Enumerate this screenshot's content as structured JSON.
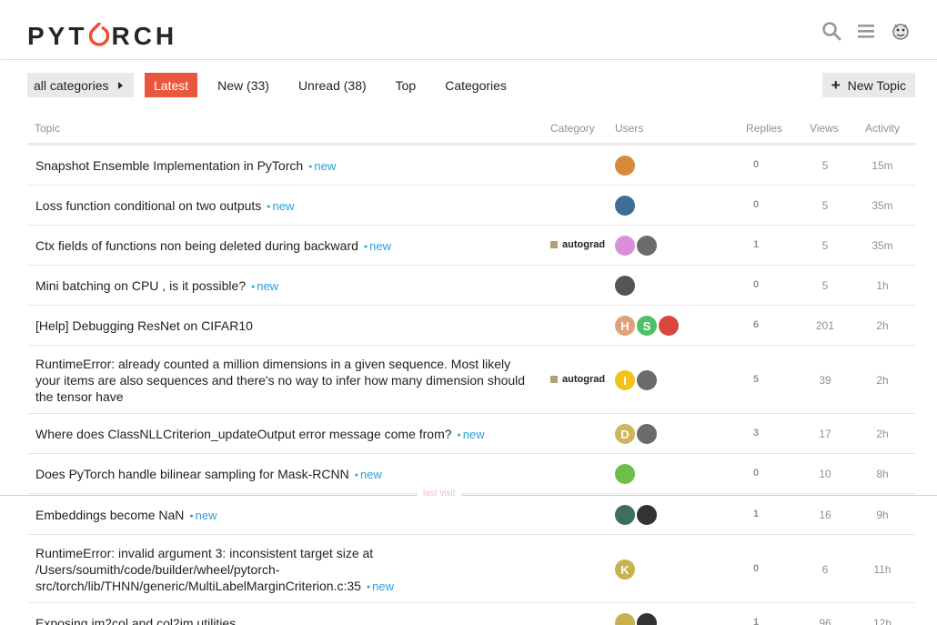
{
  "header": {
    "logo_text": [
      "PYT",
      "RCH"
    ],
    "icons": [
      "search-icon",
      "hamburger-menu-icon",
      "user-avatar-icon"
    ],
    "accent": "#ee4c2c"
  },
  "nav": {
    "category_dropdown": "all categories",
    "tabs": [
      "Latest",
      "New (33)",
      "Unread (38)",
      "Top",
      "Categories"
    ],
    "active_tab": "Latest",
    "new_topic": "New Topic"
  },
  "columns": {
    "topic": "Topic",
    "category": "Category",
    "users": "Users",
    "replies": "Replies",
    "views": "Views",
    "activity": "Activity"
  },
  "new_badge": "new",
  "last_visit_label": "last visit",
  "topics": [
    {
      "title": "Snapshot Ensemble Implementation in PyTorch",
      "new": true,
      "category": "",
      "users": [
        {
          "letter": "",
          "color": "#d88a3b"
        }
      ],
      "replies": "0",
      "views": "5",
      "activity": "15m"
    },
    {
      "title": "Loss function conditional on two outputs",
      "new": true,
      "category": "",
      "users": [
        {
          "letter": "",
          "color": "#3f6d9a"
        }
      ],
      "replies": "0",
      "views": "5",
      "activity": "35m"
    },
    {
      "title": "Ctx fields of functions non being deleted during backward",
      "new": true,
      "category": "autograd",
      "users": [
        {
          "letter": "",
          "color": "#d98fd9"
        },
        {
          "letter": "",
          "color": "#6b6b6b"
        }
      ],
      "replies": "1",
      "views": "5",
      "activity": "35m"
    },
    {
      "title": "Mini batching on CPU , is it possible?",
      "new": true,
      "category": "",
      "users": [
        {
          "letter": "",
          "color": "#555555"
        }
      ],
      "replies": "0",
      "views": "5",
      "activity": "1h"
    },
    {
      "title": "[Help] Debugging ResNet on CIFAR10",
      "new": false,
      "category": "",
      "users": [
        {
          "letter": "H",
          "color": "#e0a07a"
        },
        {
          "letter": "S",
          "color": "#4fbf6a"
        },
        {
          "letter": "",
          "color": "#d9473f"
        }
      ],
      "replies": "6",
      "views": "201",
      "activity": "2h"
    },
    {
      "title": "RuntimeError: already counted a million dimensions in a given sequence. Most likely your items are also sequences and there's no way to infer how many dimension should the tensor have",
      "new": false,
      "category": "autograd",
      "users": [
        {
          "letter": "I",
          "color": "#f2c318"
        },
        {
          "letter": "",
          "color": "#6b6b6b"
        }
      ],
      "replies": "5",
      "views": "39",
      "activity": "2h"
    },
    {
      "title": "Where does ClassNLLCriterion_updateOutput error message come from?",
      "new": true,
      "category": "",
      "users": [
        {
          "letter": "D",
          "color": "#cfb65a"
        },
        {
          "letter": "",
          "color": "#6b6b6b"
        }
      ],
      "replies": "3",
      "views": "17",
      "activity": "2h"
    },
    {
      "title": "Does PyTorch handle bilinear sampling for Mask-RCNN",
      "new": true,
      "category": "",
      "users": [
        {
          "letter": "",
          "color": "#6dbf4a"
        }
      ],
      "replies": "0",
      "views": "10",
      "activity": "8h"
    },
    {
      "title": "Embeddings become NaN",
      "new": true,
      "category": "",
      "users": [
        {
          "letter": "",
          "color": "#3d6f5a"
        },
        {
          "letter": "",
          "color": "#333333"
        }
      ],
      "replies": "1",
      "views": "16",
      "activity": "9h"
    },
    {
      "title": "RuntimeError: invalid argument 3: inconsistent target size at /Users/soumith/code/builder/wheel/pytorch-src/torch/lib/THNN/generic/MultiLabelMarginCriterion.c:35",
      "new": true,
      "category": "",
      "users": [
        {
          "letter": "K",
          "color": "#c8b24c"
        }
      ],
      "replies": "0",
      "views": "6",
      "activity": "11h"
    },
    {
      "title": "Exposing im2col and col2im utilities",
      "new": false,
      "category": "",
      "users": [
        {
          "letter": "",
          "color": "#c8b24c"
        },
        {
          "letter": "",
          "color": "#333333"
        }
      ],
      "replies": "1",
      "views": "96",
      "activity": "12h"
    }
  ]
}
